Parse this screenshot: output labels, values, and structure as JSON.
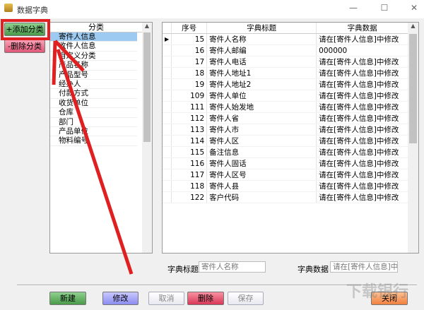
{
  "window": {
    "title": "数据字典",
    "minimize": "—",
    "maximize": "☐",
    "close": "✕"
  },
  "left_buttons": {
    "add": "+添加分类",
    "delete": "-删除分类"
  },
  "category_list": {
    "header": "分类",
    "selected_index": 0,
    "items": [
      "寄件人信息",
      "收件人信息",
      "自定义分类",
      "产品名称",
      "产品型号",
      "经办人",
      "付款方式",
      "收货单位",
      "仓库",
      "部门",
      "产品单位",
      "物料编号"
    ]
  },
  "table": {
    "columns": [
      "序号",
      "字典标题",
      "字典数据"
    ],
    "current_row": 0,
    "rows": [
      [
        "15",
        "寄件人名称",
        "请在[寄件人信息]中修改"
      ],
      [
        "16",
        "寄件人邮编",
        "000000"
      ],
      [
        "17",
        "寄件人电话",
        "请在[寄件人信息]中修改"
      ],
      [
        "18",
        "寄件人地址1",
        "请在[寄件人信息]中修改"
      ],
      [
        "19",
        "寄件人地址2",
        "请在[寄件人信息]中修改"
      ],
      [
        "109",
        "寄件人单位",
        "请在[寄件人信息]中修改"
      ],
      [
        "111",
        "寄件人始发地",
        "请在[寄件人信息]中修改"
      ],
      [
        "112",
        "寄件人省",
        "请在[寄件人信息]中修改"
      ],
      [
        "113",
        "寄件人市",
        "请在[寄件人信息]中修改"
      ],
      [
        "114",
        "寄件人区",
        "请在[寄件人信息]中修改"
      ],
      [
        "115",
        "备注信息",
        "请在[寄件人信息]中修改"
      ],
      [
        "116",
        "寄件人固话",
        "请在[寄件人信息]中修改"
      ],
      [
        "117",
        "寄件人区号",
        "请在[寄件人信息]中修改"
      ],
      [
        "118",
        "寄件人县",
        "请在[寄件人信息]中修改"
      ],
      [
        "122",
        "客户代码",
        "请在[寄件人信息]中修改"
      ]
    ]
  },
  "form": {
    "title_label": "字典标题",
    "title_value": "寄件人名称",
    "data_label": "字典数据",
    "data_value": "请在[寄件人信息]中修"
  },
  "bottom_buttons": {
    "new": "新建",
    "edit": "修改",
    "cancel": "取消",
    "delete": "删除",
    "save": "保存",
    "close": "关闭"
  },
  "watermark": "下载银行",
  "colors": {
    "annotation": "#e02020",
    "selection": "#9ccaf0"
  }
}
